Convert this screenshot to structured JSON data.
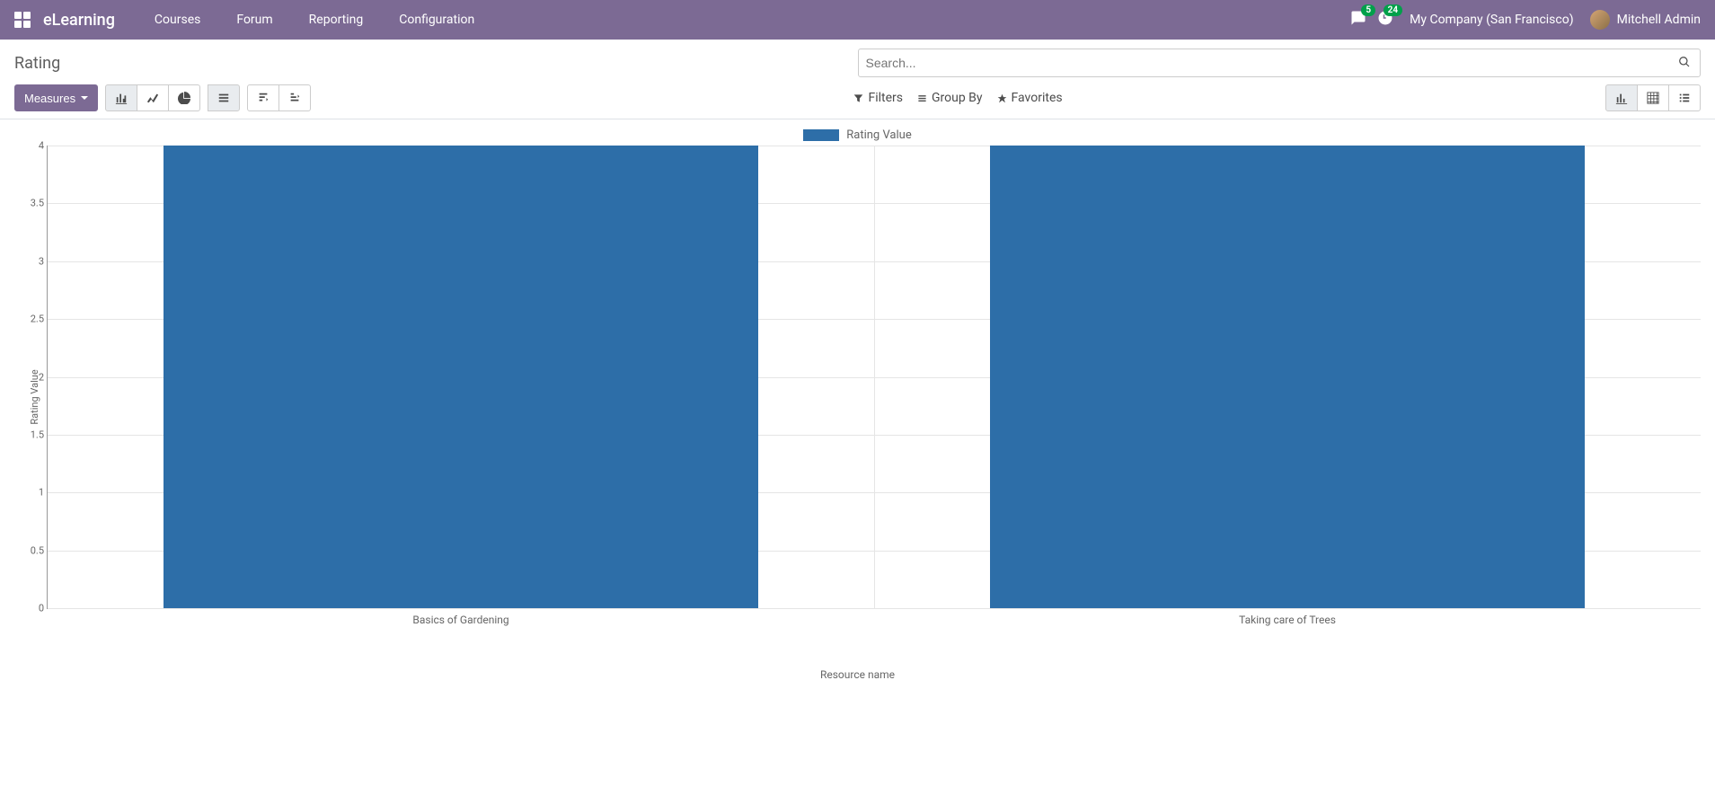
{
  "navbar": {
    "brand": "eLearning",
    "menu": [
      "Courses",
      "Forum",
      "Reporting",
      "Configuration"
    ],
    "messages_count": "5",
    "activities_count": "24",
    "company": "My Company (San Francisco)",
    "user": "Mitchell Admin"
  },
  "page": {
    "title": "Rating",
    "search_placeholder": "Search...",
    "measures_label": "Measures",
    "filters": "Filters",
    "group_by": "Group By",
    "favorites": "Favorites"
  },
  "chart_data": {
    "type": "bar",
    "categories": [
      "Basics of Gardening",
      "Taking care of Trees"
    ],
    "values": [
      4,
      4
    ],
    "legend": "Rating Value",
    "xlabel": "Resource name",
    "ylabel": "Rating Value",
    "ylim": [
      0,
      4
    ],
    "yticks": [
      0,
      0.5,
      1,
      1.5,
      2,
      2.5,
      3,
      3.5,
      4
    ]
  }
}
